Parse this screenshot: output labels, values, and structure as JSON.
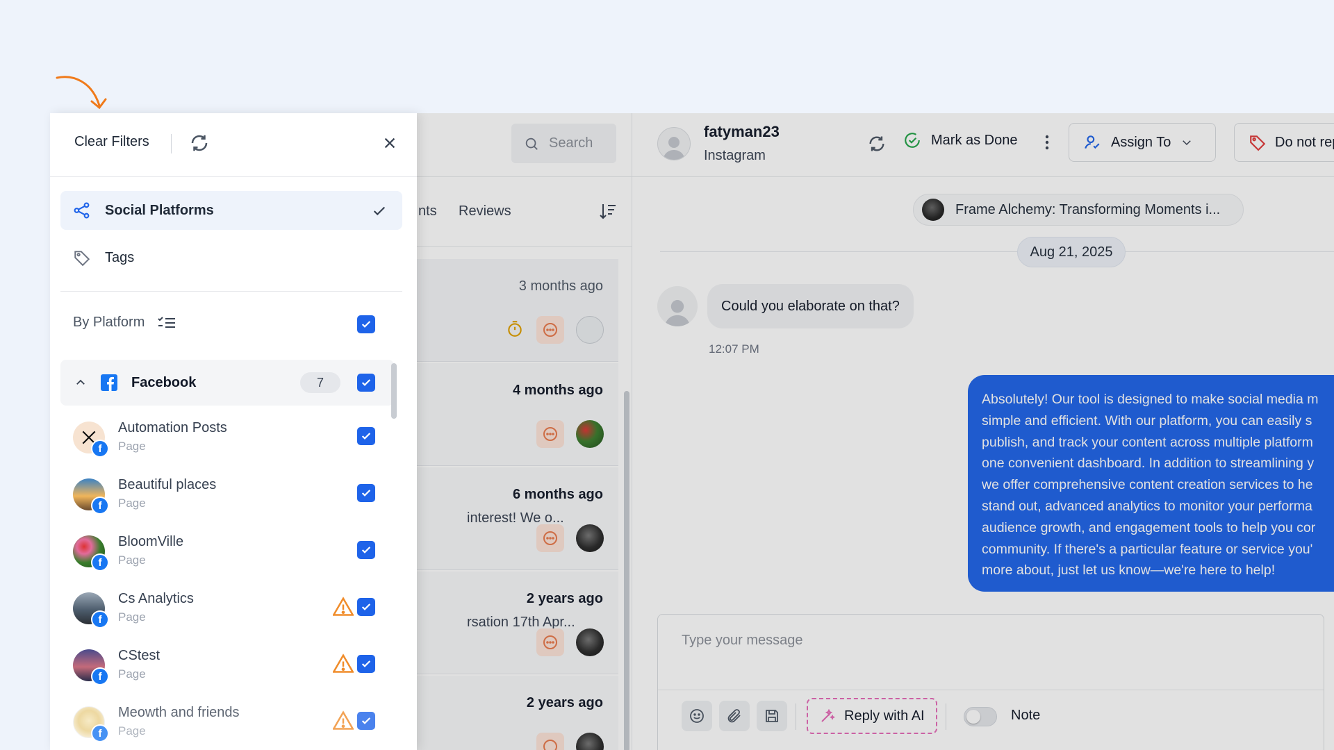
{
  "filters": {
    "clear_label": "Clear Filters",
    "nav": [
      {
        "label": "Social Platforms",
        "active": true
      },
      {
        "label": "Tags",
        "active": false
      }
    ],
    "by_platform_label": "By Platform",
    "group": {
      "name": "Facebook",
      "count": "7"
    },
    "accounts": [
      {
        "name": "Automation Posts",
        "type": "Page",
        "warning": false
      },
      {
        "name": "Beautiful places",
        "type": "Page",
        "warning": false
      },
      {
        "name": "BloomVille",
        "type": "Page",
        "warning": false
      },
      {
        "name": "Cs Analytics",
        "type": "Page",
        "warning": true
      },
      {
        "name": "CStest",
        "type": "Page",
        "warning": true
      },
      {
        "name": "Meowth and friends",
        "type": "Page",
        "warning": true
      }
    ]
  },
  "inbox": {
    "search_placeholder": "Search",
    "tabs": [
      "nts",
      "Reviews"
    ],
    "conversations": [
      {
        "time": "3 months ago",
        "snippet": "",
        "unread": false
      },
      {
        "time": "4 months ago",
        "snippet": "",
        "unread": true
      },
      {
        "time": "6 months ago",
        "snippet": "interest! We o...",
        "unread": true
      },
      {
        "time": "2 years ago",
        "snippet": "rsation 17th Apr...",
        "unread": true
      },
      {
        "time": "2 years ago",
        "snippet": "",
        "unread": true
      }
    ]
  },
  "thread": {
    "contact_name": "fatyman23",
    "contact_platform": "Instagram",
    "mark_done_label": "Mark as Done",
    "assign_label": "Assign To",
    "do_not_reply_label": "Do not rep",
    "post_title": "Frame Alchemy: Transforming Moments i...",
    "date_label": "Aug 21, 2025",
    "incoming_message": "Could you elaborate on that?",
    "incoming_time": "12:07 PM",
    "outgoing_message": "Absolutely! Our tool is designed to make social media m\nsimple and efficient. With our platform, you can easily s\npublish, and track your content across multiple platform\none convenient dashboard. In addition to streamlining y\nwe offer comprehensive content creation services to he\nstand out, advanced analytics to monitor your performa\naudience growth, and engagement tools to help you cor\ncommunity. If there's a particular feature or service you'\nmore about, just let us know—we're here to help!",
    "composer_placeholder": "Type your message",
    "reply_ai_label": "Reply with AI",
    "note_label": "Note"
  },
  "colors": {
    "accent": "#1e63e9",
    "facebook": "#1877f2",
    "warning": "#f08c2a",
    "success": "#22a447",
    "ai_pink": "#e66ab8"
  }
}
